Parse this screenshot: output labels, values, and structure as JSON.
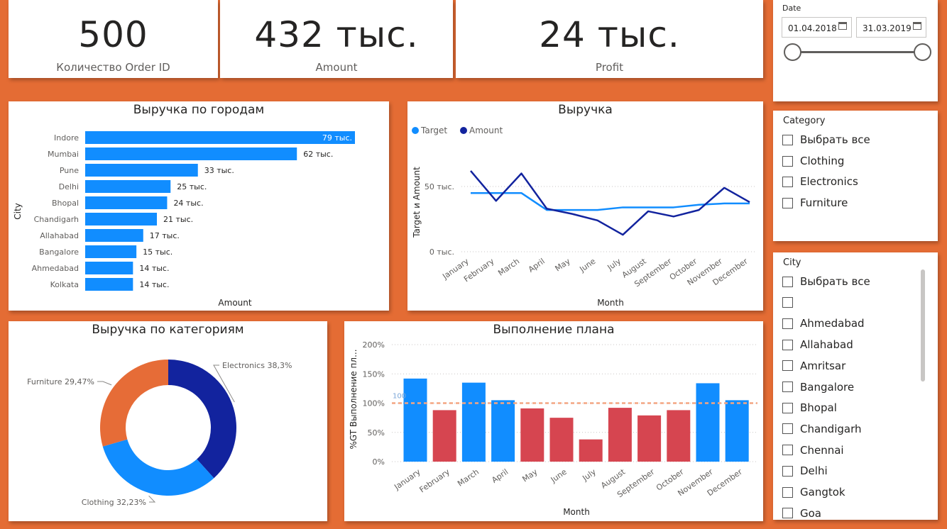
{
  "kpis": [
    {
      "value": "500",
      "label": "Количество Order ID"
    },
    {
      "value": "432 тыс.",
      "label": "Amount"
    },
    {
      "value": "24 тыс.",
      "label": "Profit"
    }
  ],
  "date_slicer": {
    "label": "Date",
    "start": "01.04.2018",
    "end": "31.03.2019",
    "range": [
      0,
      1
    ]
  },
  "category_slicer": {
    "title": "Category",
    "items": [
      "Выбрать все",
      "Clothing",
      "Electronics",
      "Furniture"
    ]
  },
  "city_slicer": {
    "title": "City",
    "items": [
      "Выбрать все",
      "",
      "Ahmedabad",
      "Allahabad",
      "Amritsar",
      "Bangalore",
      "Bhopal",
      "Chandigarh",
      "Chennai",
      "Delhi",
      "Gangtok",
      "Goa"
    ]
  },
  "chart_data": [
    {
      "id": "city",
      "type": "bar",
      "orientation": "horizontal",
      "title": "Выручка по городам",
      "xlabel": "Amount",
      "ylabel": "City",
      "color": "#118dff",
      "categories": [
        "Indore",
        "Mumbai",
        "Pune",
        "Delhi",
        "Bhopal",
        "Chandigarh",
        "Allahabad",
        "Bangalore",
        "Ahmedabad",
        "Kolkata"
      ],
      "values": [
        79,
        62,
        33,
        25,
        24,
        21,
        17,
        15,
        14,
        14
      ],
      "data_labels": [
        "79 тыс.",
        "62 тыс.",
        "33 тыс.",
        "25 тыс.",
        "24 тыс.",
        "21 тыс.",
        "17 тыс.",
        "15 тыс.",
        "14 тыс.",
        "14 тыс."
      ]
    },
    {
      "id": "revenue",
      "type": "line",
      "title": "Выручка",
      "xlabel": "Month",
      "ylabel": "Target и Amount",
      "x": [
        "January",
        "February",
        "March",
        "April",
        "May",
        "June",
        "July",
        "August",
        "September",
        "October",
        "November",
        "December"
      ],
      "ylim": [
        0,
        60
      ],
      "yticks": [
        {
          "value": 0,
          "label": "0 тыс."
        },
        {
          "value": 50,
          "label": "50 тыс."
        }
      ],
      "legend": "top-left",
      "series": [
        {
          "name": "Target",
          "color": "#118dff",
          "values": [
            45,
            45,
            45,
            32,
            32,
            32,
            34,
            34,
            34,
            36,
            37,
            37
          ]
        },
        {
          "name": "Amount",
          "color": "#12239e",
          "values": [
            62,
            39,
            60,
            33,
            29,
            24,
            13,
            31,
            27,
            32,
            49,
            38
          ]
        }
      ]
    },
    {
      "id": "category",
      "type": "pie",
      "title": "Выручка по категориям",
      "slices": [
        {
          "label": "Electronics 38,3%",
          "value": 38.3,
          "color": "#12239e"
        },
        {
          "label": "Clothing 32,23%",
          "value": 32.23,
          "color": "#118dff"
        },
        {
          "label": "Furniture 29,47%",
          "value": 29.47,
          "color": "#e66c37"
        }
      ]
    },
    {
      "id": "plan",
      "type": "bar",
      "title": "Выполнение плана",
      "xlabel": "Month",
      "ylabel": "%GT Выполнение пл...",
      "ylim": [
        0,
        200
      ],
      "yticks": [
        "0%",
        "50%",
        "100%",
        "150%",
        "200%"
      ],
      "reference_line": {
        "value": 100,
        "label": "100",
        "color": "#f4a582"
      },
      "above_color": "#118dff",
      "below_color": "#d64550",
      "categories": [
        "January",
        "February",
        "March",
        "April",
        "May",
        "June",
        "July",
        "August",
        "September",
        "October",
        "November",
        "December"
      ],
      "values": [
        142,
        88,
        135,
        105,
        91,
        75,
        38,
        92,
        79,
        88,
        134,
        105
      ]
    }
  ]
}
